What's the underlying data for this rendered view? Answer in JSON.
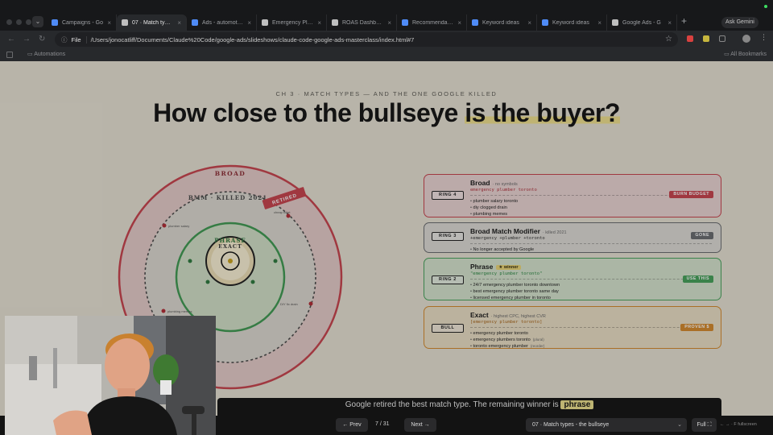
{
  "browser": {
    "tabs": [
      {
        "label": "Campaigns - Go",
        "color": "#4f8bf7",
        "active": false
      },
      {
        "label": "07 · Match types",
        "color": "#bfbfbf",
        "active": true
      },
      {
        "label": "Ads - automotive",
        "color": "#4f8bf7",
        "active": false
      },
      {
        "label": "Emergency Plumb",
        "color": "#bfbfbf",
        "active": false
      },
      {
        "label": "ROAS Dashboard",
        "color": "#bfbfbf",
        "active": false
      },
      {
        "label": "Recommendations",
        "color": "#4f8bf7",
        "active": false
      },
      {
        "label": "Keyword ideas",
        "color": "#4f8bf7",
        "active": false
      },
      {
        "label": "Keyword ideas",
        "color": "#4f8bf7",
        "active": false
      },
      {
        "label": "Google Ads - G",
        "color": "#bfbfbf",
        "active": false
      }
    ],
    "new_tab": "+",
    "gemini": "Ask Gemini",
    "address_prefix": "File",
    "url": "/Users/jonocatliff/Documents/Claude%20Code/google-ads/slideshows/claude-code-google-ads-masterclass/index.html#7",
    "bookmarks_folder": "Automations",
    "all_bookmarks": "All Bookmarks"
  },
  "slide": {
    "kicker": "CH 3 · MATCH TYPES — AND THE ONE GOOGLE KILLED",
    "headline_pre": "How close to the bullseye ",
    "headline_hl": "is the buyer?",
    "diagram": {
      "broad_label": "BROAD",
      "bmm_label": "BMM · KILLED 2021",
      "retired_stamp": "RETIRED",
      "phrase_label": "PHRASE",
      "exact_label": "EXACT",
      "dot_labels": [
        "plumber salary",
        "cheap toilet",
        "plumbing memes",
        "DIY fix drain"
      ]
    },
    "cards": [
      {
        "ring": "RING 4",
        "title": "Broad",
        "sub": "· no symbols",
        "keyword": "emergency plumber toronto",
        "examples": [
          {
            "text": "plumber salary toronto",
            "note": ""
          },
          {
            "text": "diy clogged drain",
            "note": ""
          },
          {
            "text": "plumbing memes",
            "note": ""
          }
        ],
        "badge": "BURN BUDGET"
      },
      {
        "ring": "RING 3",
        "title": "Broad Match Modifier",
        "sub": "· killed 2021",
        "keyword": "+emergency +plumber +toronto",
        "examples": [
          {
            "text": "No longer accepted by Google",
            "note": ""
          }
        ],
        "badge": "GONE"
      },
      {
        "ring": "RING 2",
        "title": "Phrase",
        "winner": "★ winner",
        "keyword": "\"emergency plumber toronto\"",
        "examples": [
          {
            "text": "24/7 emergency plumber toronto downtown",
            "note": ""
          },
          {
            "text": "best emergency plumber toronto same day",
            "note": ""
          },
          {
            "text": "licensed emergency plumber in toronto",
            "note": ""
          }
        ],
        "badge": "USE THIS"
      },
      {
        "ring": "BULL",
        "title": "Exact",
        "sub": "· highest CPC, highest CVR",
        "keyword": "[emergency plumber toronto]",
        "examples": [
          {
            "text": "emergency plumber toronto",
            "note": ""
          },
          {
            "text": "emergency plumbers toronto",
            "note": "(plural)"
          },
          {
            "text": "toronto emergency plumber",
            "note": "(reorder)"
          }
        ],
        "badge": "PROVEN $"
      }
    ],
    "banner_pre": "Google retired the best match type. The remaining winner is ",
    "banner_hl": "phrase"
  },
  "controls": {
    "prev": "← Prev",
    "page": "7 / 31",
    "next": "Next →",
    "slide_select": "07 · Match types - the bullseye",
    "full": "Full ⛶",
    "hint": "← → · F fullscreen"
  },
  "colors": {
    "broad": "#c8434e",
    "bmm": "#6a6c70",
    "phrase": "#46a25a",
    "exact": "#d58a2c",
    "slide_bg": "#e7e2d4"
  }
}
